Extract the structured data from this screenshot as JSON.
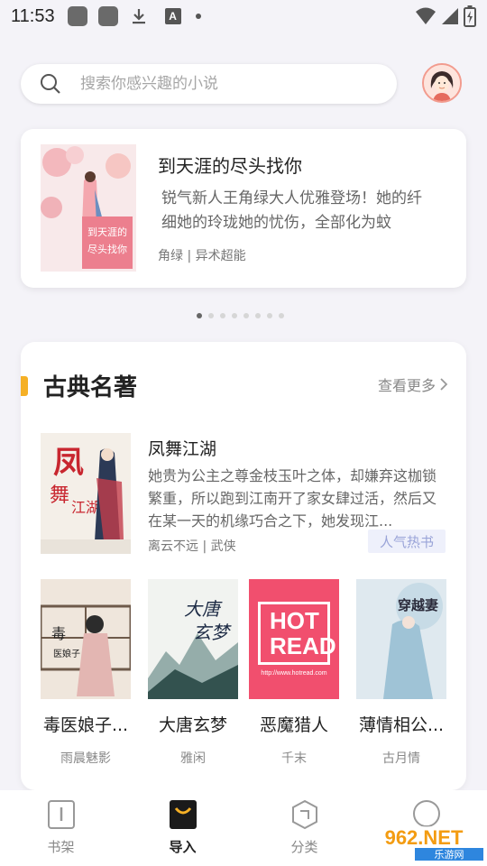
{
  "status_bar": {
    "time": "11:53"
  },
  "search": {
    "placeholder": "搜索你感兴趣的小说"
  },
  "banner": {
    "title": "到天涯的尽头找你",
    "desc": "锐气新人王角绿大人优雅登场！她的纤细她的玲珑她的忧伤，全部化为蚊",
    "meta": "角绿 | 异术超能",
    "cover_text": "到天涯的尽头找你"
  },
  "section": {
    "title": "古典名著",
    "more": "查看更多",
    "featured": {
      "title": "凤舞江湖",
      "desc": "她贵为公主之尊金枝玉叶之体，却嫌弃这枷锁繁重，所以跑到江南开了家女肆过活，然后又在某一天的机缘巧合之下，她发现江...",
      "meta": "离云不远 | 武侠",
      "badge": "人气热书",
      "cover_text": "凤舞江湖"
    },
    "books": [
      {
        "title": "毒医娘子...",
        "author": "雨晨魅影",
        "cover_text": "毒医娘子"
      },
      {
        "title": "大唐玄梦",
        "author": "雅闲",
        "cover_text": "大唐玄梦"
      },
      {
        "title": "恶魔猎人",
        "author": "千末",
        "cover_text": "HOT READ",
        "cover_sub": "http://www.hotread.com"
      },
      {
        "title": "薄情相公...",
        "author": "古月情",
        "cover_text": "穿越妻"
      }
    ]
  },
  "nav": [
    {
      "label": "书架",
      "icon": "book-icon"
    },
    {
      "label": "导入",
      "icon": "bag-icon"
    },
    {
      "label": "分类",
      "icon": "category-icon"
    },
    {
      "label": "",
      "icon": "profile-icon"
    }
  ],
  "watermark": {
    "text": "962.NET",
    "sub": "乐游网"
  }
}
